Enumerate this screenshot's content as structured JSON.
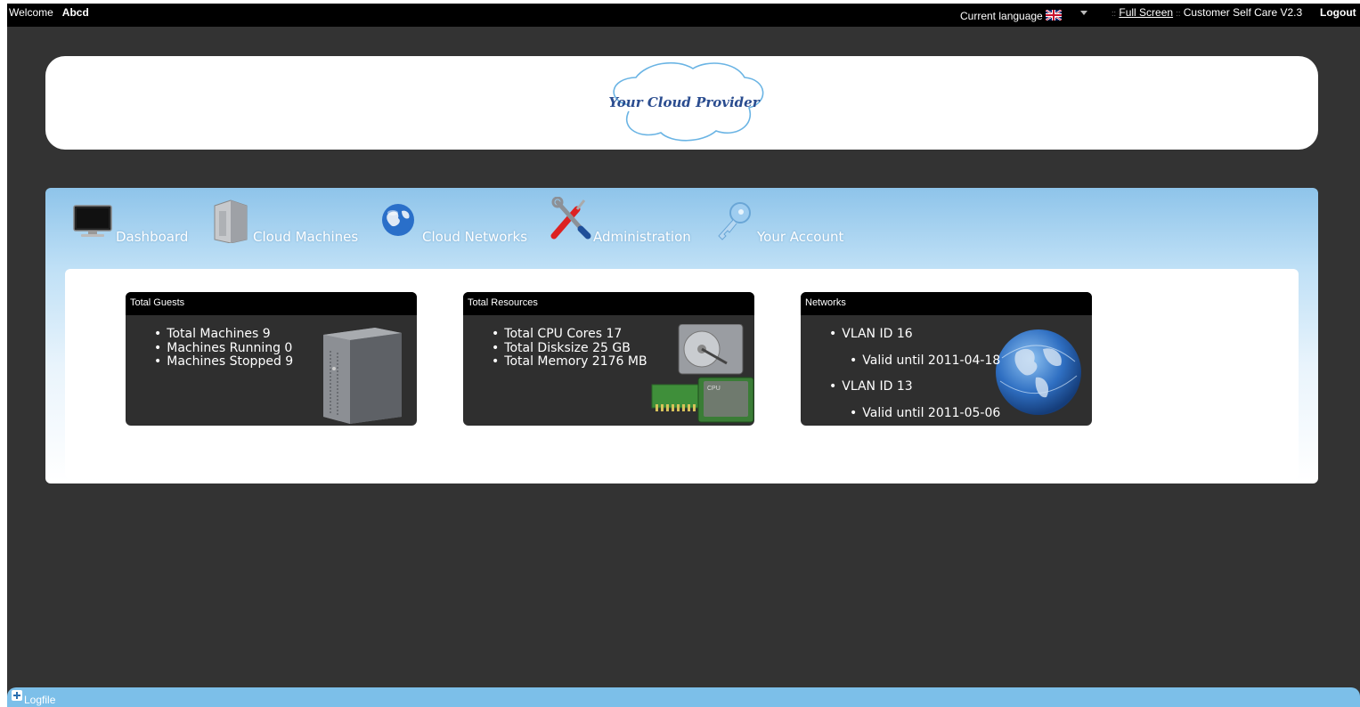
{
  "topbar": {
    "welcome_label": "Welcome",
    "username": "Abcd",
    "language_label": "Current language",
    "separator": "::",
    "fullscreen_label": "Full Screen",
    "app_version": "Customer Self Care V2.3",
    "logout_label": "Logout"
  },
  "header": {
    "logo_text": "Your Cloud Provider"
  },
  "nav": {
    "items": [
      {
        "label": "Dashboard",
        "icon": "monitor-icon"
      },
      {
        "label": "Cloud Machines",
        "icon": "server-icon"
      },
      {
        "label": "Cloud Networks",
        "icon": "globe-icon"
      },
      {
        "label": "Administration",
        "icon": "tools-icon"
      },
      {
        "label": "Your Account",
        "icon": "key-icon"
      }
    ]
  },
  "widgets": {
    "guests": {
      "title": "Total Guests",
      "items": [
        "Total Machines 9",
        "Machines Running 0",
        "Machines Stopped 9"
      ]
    },
    "resources": {
      "title": "Total Resources",
      "items": [
        "Total CPU Cores 17",
        "Total Disksize 25 GB",
        "Total Memory 2176 MB"
      ],
      "cpu_label": "CPU"
    },
    "networks": {
      "title": "Networks",
      "items": [
        "VLAN ID 16",
        "Valid until 2011-04-18",
        "VLAN ID 13",
        "Valid until 2011-05-06"
      ]
    }
  },
  "logfile": {
    "label": "Logfile"
  },
  "colors": {
    "background": "#333333",
    "topbar": "#000000",
    "nav_gradient_top": "#8ec4ea",
    "logbar": "#7cbfe9",
    "widget_bg": "#2f2f2f"
  }
}
